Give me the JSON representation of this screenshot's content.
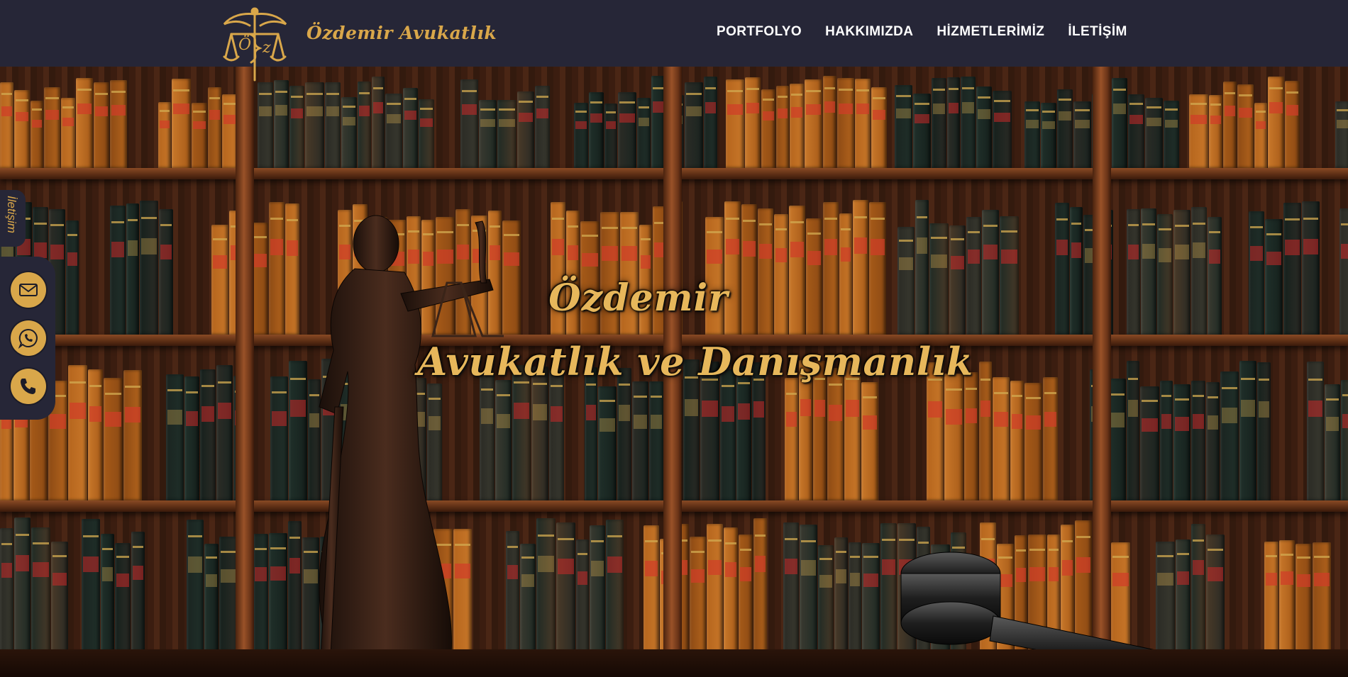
{
  "header": {
    "brand": "Özdemir Avukatlık",
    "nav": [
      "PORTFOLYO",
      "HAKKIMIZDA",
      "HİZMETLERİMİZ",
      "İLETİŞİM"
    ]
  },
  "hero": {
    "title_line1": "Özdemir",
    "title_line2": "Avukatlık ve Danışmanlık"
  },
  "contact": {
    "tab_label": "İletişim",
    "buttons": [
      {
        "icon": "mail-icon"
      },
      {
        "icon": "whatsapp-icon"
      },
      {
        "icon": "phone-icon"
      }
    ]
  },
  "colors": {
    "header_bg": "#262637",
    "accent_gold": "#d9a74a",
    "nav_text": "#ffffff"
  }
}
